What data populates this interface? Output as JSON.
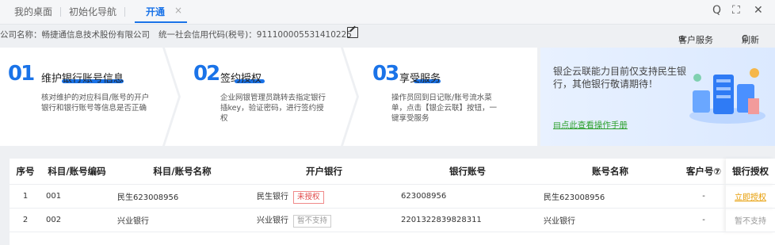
{
  "tabs": [
    {
      "label": "我的桌面"
    },
    {
      "label": "初始化导航"
    },
    {
      "label": "开通"
    }
  ],
  "tab_close": "×",
  "window_controls": {
    "search": "Q",
    "maximize": "⛶",
    "close": "✕"
  },
  "company": {
    "name_label": "公司名称：畅捷通信息技术股份有限公司",
    "credit_label": "统一社会信用代码(税号)：911100005531410225"
  },
  "links": {
    "customer_service": "客户服务",
    "refresh": "刷新"
  },
  "steps": [
    {
      "num": "01",
      "title": "维护银行账号信息",
      "desc": "核对维护的对应科目/账号的开户\n银行和银行账号等信息是否正确"
    },
    {
      "num": "02",
      "title": "签约授权",
      "desc": "企业网银管理员跳转去指定银行\n插key，验证密码，进行签约授\n权"
    },
    {
      "num": "03",
      "title": "享受服务",
      "desc": "操作员回到日记账/账号流水菜\n单，点击【银企云联】按钮，一\n键享受服务"
    }
  ],
  "promo": {
    "text": "银企云联能力目前仅支持民生银行，其他银行敬请期待！",
    "link": "点此查看操作手册"
  },
  "table": {
    "headers": [
      "序号",
      "科目/账号编码",
      "科目/账号名称",
      "开户银行",
      "银行账号",
      "账号名称",
      "客户号⑦",
      "银行授权"
    ],
    "rows": [
      {
        "idx": "1",
        "code": "001",
        "name": "民生623008956",
        "bank": "民生银行",
        "tag": "未授权",
        "account": "623008956",
        "acct_name": "民生623008956",
        "customer": "-",
        "auth": "立即授权"
      },
      {
        "idx": "2",
        "code": "002",
        "name": "兴业银行",
        "bank": "兴业银行",
        "tag": "暂不支持",
        "account": "2201322839828311",
        "acct_name": "兴业银行",
        "customer": "-",
        "auth": "暂不支持"
      }
    ]
  },
  "colors": {
    "accent": "#1a73e8",
    "warning": "#e69b00",
    "danger": "#e04848",
    "link_green": "#2ca02c"
  }
}
